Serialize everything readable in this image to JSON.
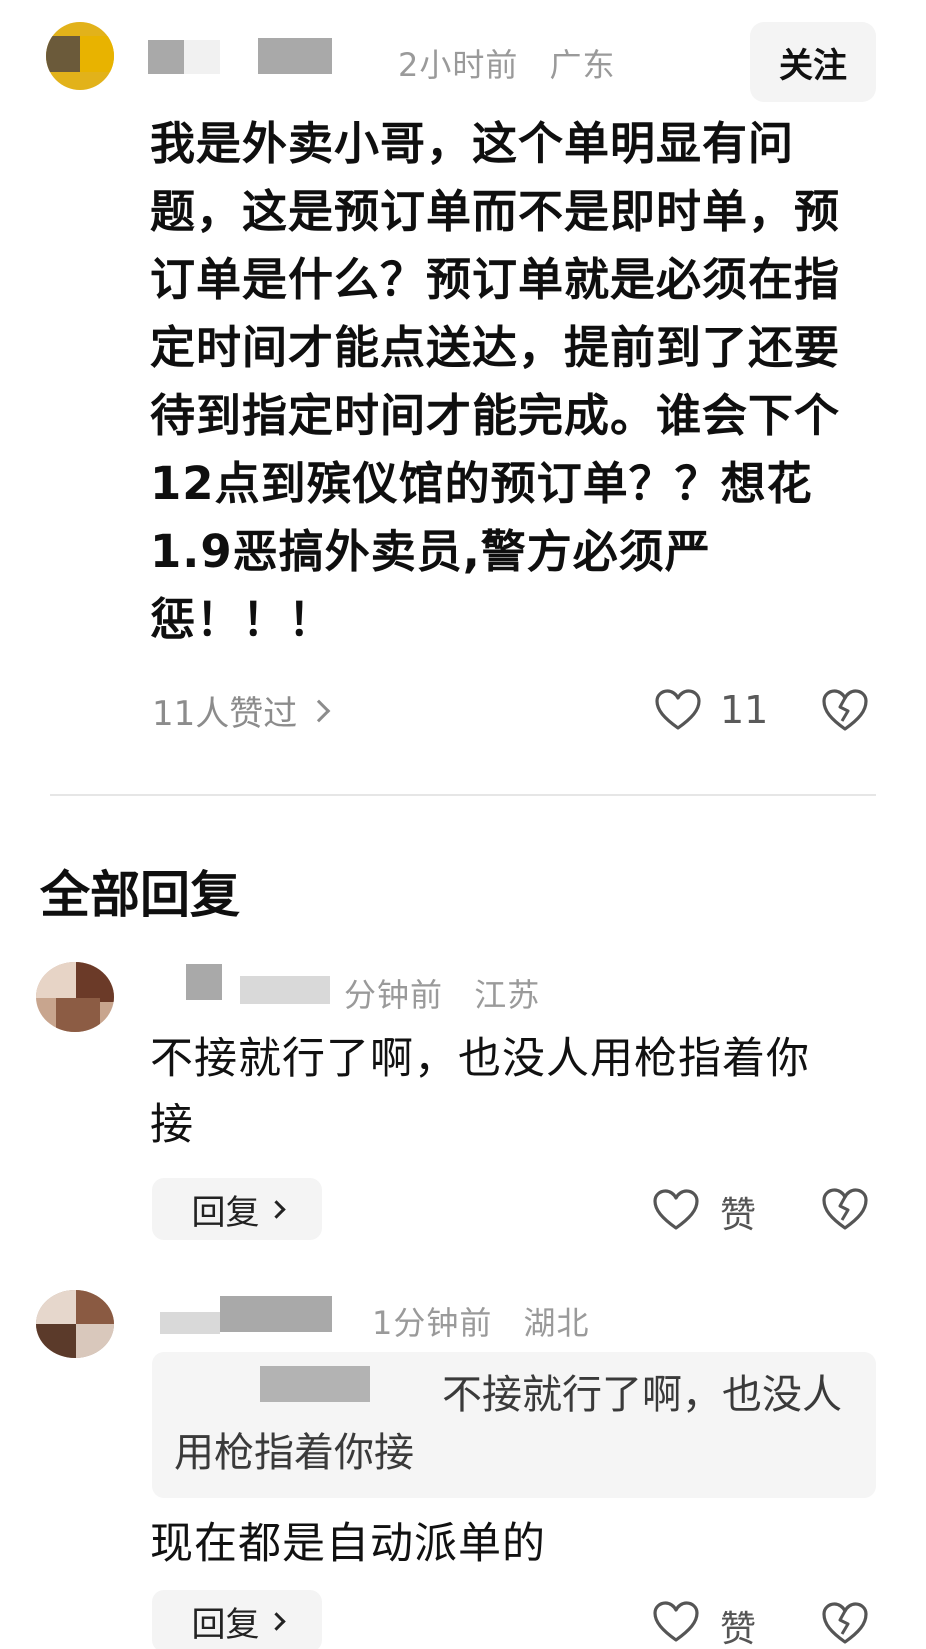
{
  "top_comment": {
    "time": "2小时前",
    "location": "广东",
    "follow_label": "关注",
    "text": "我是外卖小哥，这个单明显有问题，这是预订单而不是即时单，预订单是什么？预订单就是必须在指定时间才能点送达，提前到了还要待到指定时间才能完成。谁会下个12点到殡仪馆的预订单？？想花1.9恶搞外卖员,警方必须严惩！！！",
    "likers_label": "11人赞过",
    "like_count": "11"
  },
  "replies_section": {
    "title": "全部回复"
  },
  "replies": [
    {
      "time": "分钟前",
      "location": "江苏",
      "text": "不接就行了啊，也没人用枪指着你接",
      "reply_label": "回复",
      "like_label": "赞"
    },
    {
      "time": "1分钟前",
      "location": "湖北",
      "quote": "不接就行了啊，也没人用枪指着你接",
      "text": "现在都是自动派单的",
      "reply_label": "回复",
      "like_label": "赞"
    }
  ],
  "icons": {
    "like": "heart-outline-icon",
    "dislike": "broken-heart-icon",
    "more": "chevron-right-icon"
  }
}
